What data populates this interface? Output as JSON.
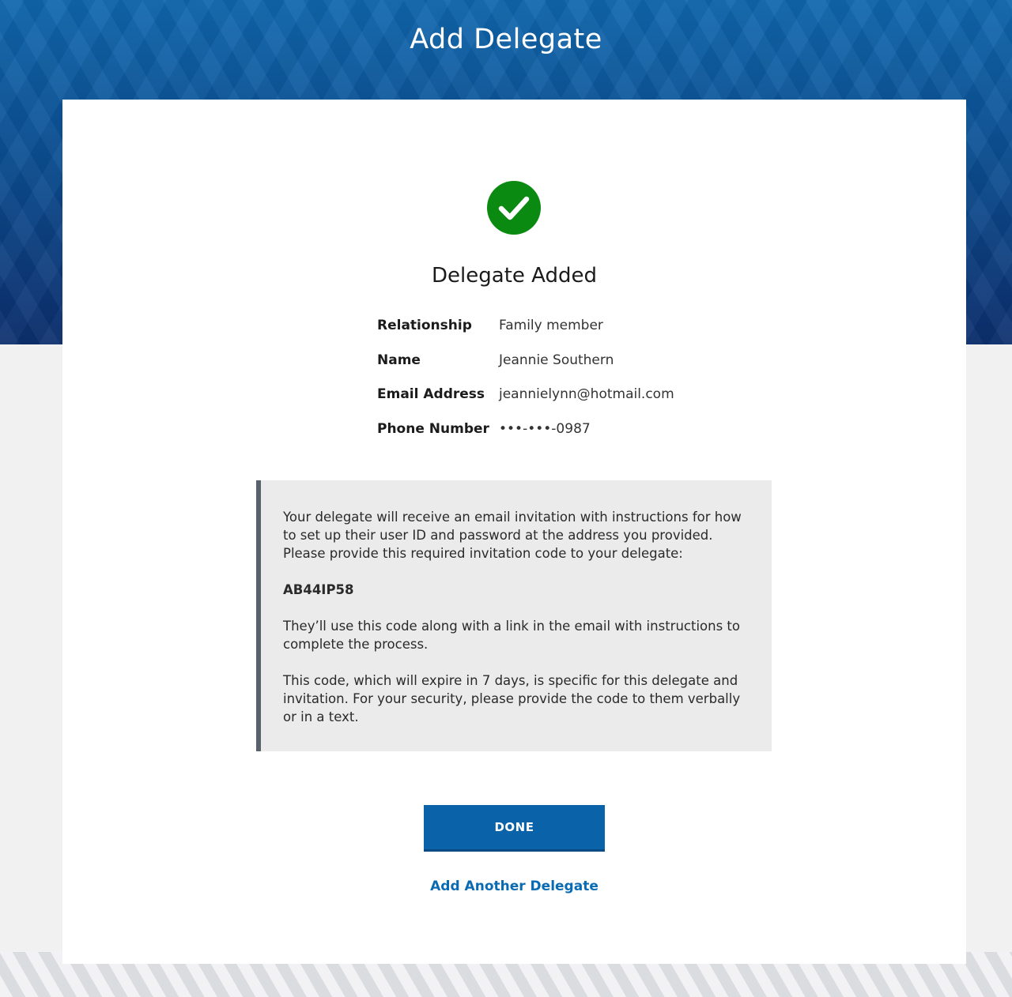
{
  "header": {
    "title": "Add Delegate"
  },
  "confirmation": {
    "icon": "check-circle-icon",
    "icon_color": "#0a8a10",
    "title": "Delegate Added"
  },
  "details": [
    {
      "label": "Relationship",
      "value": "Family member"
    },
    {
      "label": "Name",
      "value": "Jeannie Southern"
    },
    {
      "label": "Email Address",
      "value": "jeannielynn@hotmail.com"
    },
    {
      "label": "Phone Number",
      "value": "•••-•••-0987"
    }
  ],
  "info": {
    "paragraph_1": "Your delegate will receive an email invitation with instructions for how to set up their user ID and password at the address you provided. Please provide this required invitation code to your delegate:",
    "code": "AB44IP58",
    "paragraph_2": "They’ll use this code along with a link in the email with instructions to complete the process.",
    "paragraph_3": "This code, which will expire in 7 days, is specific for this delegate and invitation. For your security, please provide the code to them verbally or in a text."
  },
  "actions": {
    "done_label": "DONE",
    "add_another_label": "Add Another Delegate"
  },
  "colors": {
    "primary": "#0a63a9",
    "success": "#0a8a10",
    "link": "#0a6bb3"
  }
}
